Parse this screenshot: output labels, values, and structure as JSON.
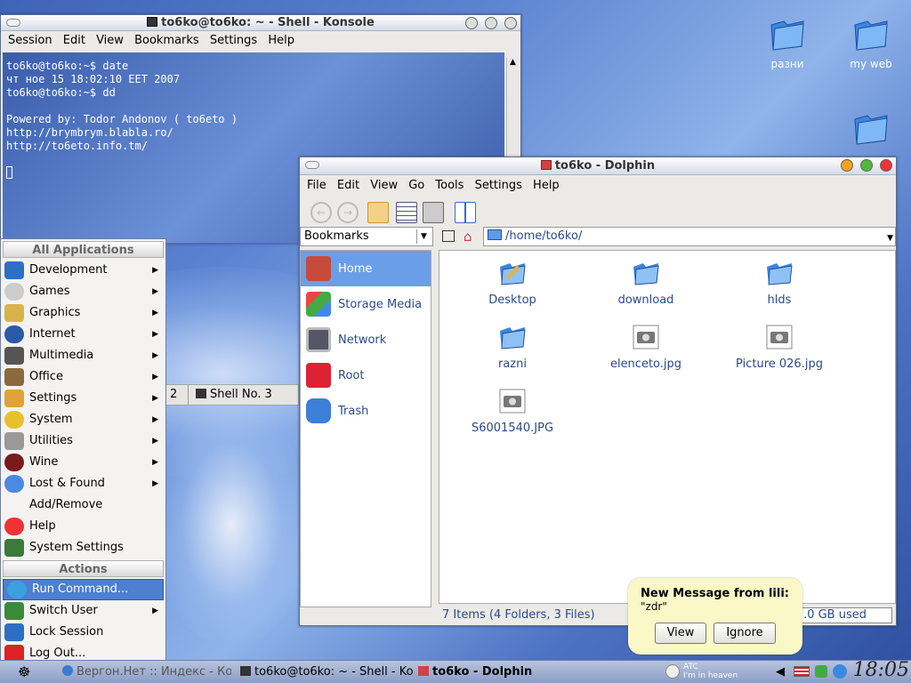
{
  "desktop": {
    "icons": [
      {
        "label": "разни"
      },
      {
        "label": "my web"
      },
      {
        "label": ""
      }
    ]
  },
  "konsole": {
    "title": "to6ko@to6ko: ~ - Shell - Konsole",
    "menu": [
      "Session",
      "Edit",
      "View",
      "Bookmarks",
      "Settings",
      "Help"
    ],
    "lines": [
      "to6ko@to6ko:~$ date",
      "чт ное 15 18:02:10 EET 2007",
      "to6ko@to6ko:~$ dd",
      "",
      "Powered by: Todor Andonov ( to6eto )",
      "http://brymbrym.blabla.ro/",
      "http://to6eto.info.tm/"
    ],
    "tabs": [
      "2",
      "Shell No. 3"
    ]
  },
  "dolphin": {
    "title": "to6ko - Dolphin",
    "menu": [
      "File",
      "Edit",
      "View",
      "Go",
      "Tools",
      "Settings",
      "Help"
    ],
    "bookmarks_label": "Bookmarks",
    "path": "/home/to6ko/",
    "sidebar": [
      "Home",
      "Storage Media",
      "Network",
      "Root",
      "Trash"
    ],
    "files": [
      {
        "name": "Desktop",
        "type": "desktop"
      },
      {
        "name": "download",
        "type": "folder"
      },
      {
        "name": "hlds",
        "type": "folder"
      },
      {
        "name": "razni",
        "type": "folder"
      },
      {
        "name": "elenceto.jpg",
        "type": "image"
      },
      {
        "name": "Picture 026.jpg",
        "type": "image"
      },
      {
        "name": "S6001540.JPG",
        "type": "image"
      }
    ],
    "status": "7 Items (4 Folders, 3 Files)",
    "disk": "2.0 GB used"
  },
  "kmenu": {
    "header_apps": "All Applications",
    "apps": [
      "Development",
      "Games",
      "Graphics",
      "Internet",
      "Multimedia",
      "Office",
      "Settings",
      "System",
      "Utilities",
      "Wine",
      "Lost & Found",
      "Add/Remove",
      "Help",
      "System Settings"
    ],
    "header_actions": "Actions",
    "actions": [
      "Run Command...",
      "Switch User",
      "Lock Session",
      "Log Out..."
    ]
  },
  "notification": {
    "title": "New Message from lili:",
    "body": "\"zdr\"",
    "view": "View",
    "ignore": "Ignore"
  },
  "taskbar": {
    "tasks": [
      "Вергон.Нет :: Индекс - Ко",
      "to6ko@to6ko: ~ - Shell - Ko",
      "to6ko - Dolphin"
    ],
    "player": [
      "ATC",
      "I'm in heaven"
    ],
    "clock": "18:05"
  },
  "colors": {
    "accent": "#4e7fd0",
    "link": "#2a4a8c",
    "selection": "#6b9ee8"
  }
}
